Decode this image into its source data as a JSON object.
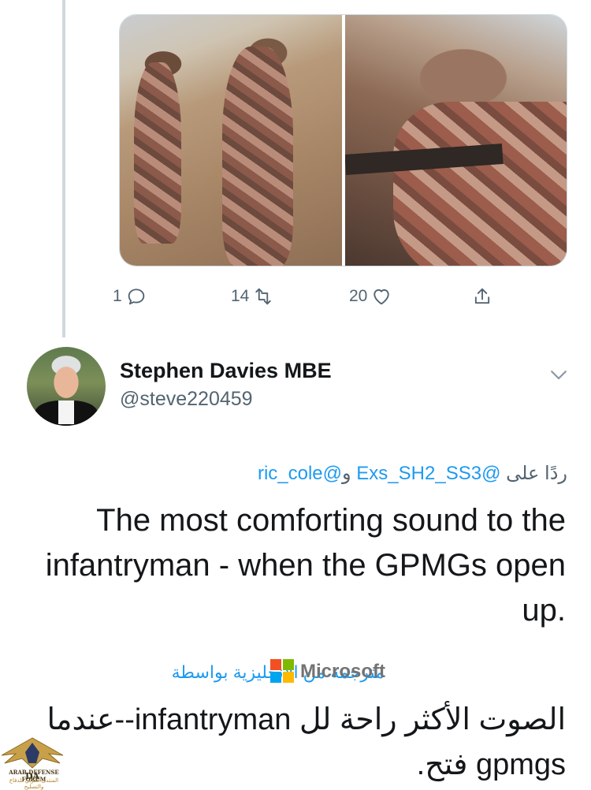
{
  "previous_tweet": {
    "actions": {
      "reply_count": "1",
      "retweet_count": "14",
      "like_count": "20"
    }
  },
  "tweet": {
    "author_name": "Stephen Davies MBE",
    "author_handle": "@steve220459",
    "reply_prefix": "ردًا على ",
    "reply_to_1": "@Exs_SH2_SS3",
    "reply_join": " و",
    "reply_to_2": "@ric_cole",
    "text": "The most comforting sound to the infantryman - when the GPMGs open up.",
    "translation_label": "مترجمة من الإنجليزية بواسطة",
    "translator_brand": "Microsoft",
    "translated_text": "الصوت الأكثر راحة لل infantryman--عندما gpmgs فتح."
  },
  "watermark": {
    "initials": "DA",
    "title": "ARAB DEFENSE FORUM",
    "subtitle": "المنتدى العربي للدفاع والتسليح"
  },
  "colors": {
    "link": "#1d9bf0",
    "secondary_text": "#536471",
    "thread_line": "#cfd9de"
  },
  "icons": [
    "reply-icon",
    "retweet-icon",
    "like-icon",
    "share-icon",
    "chevron-down-icon",
    "microsoft-logo-icon"
  ]
}
